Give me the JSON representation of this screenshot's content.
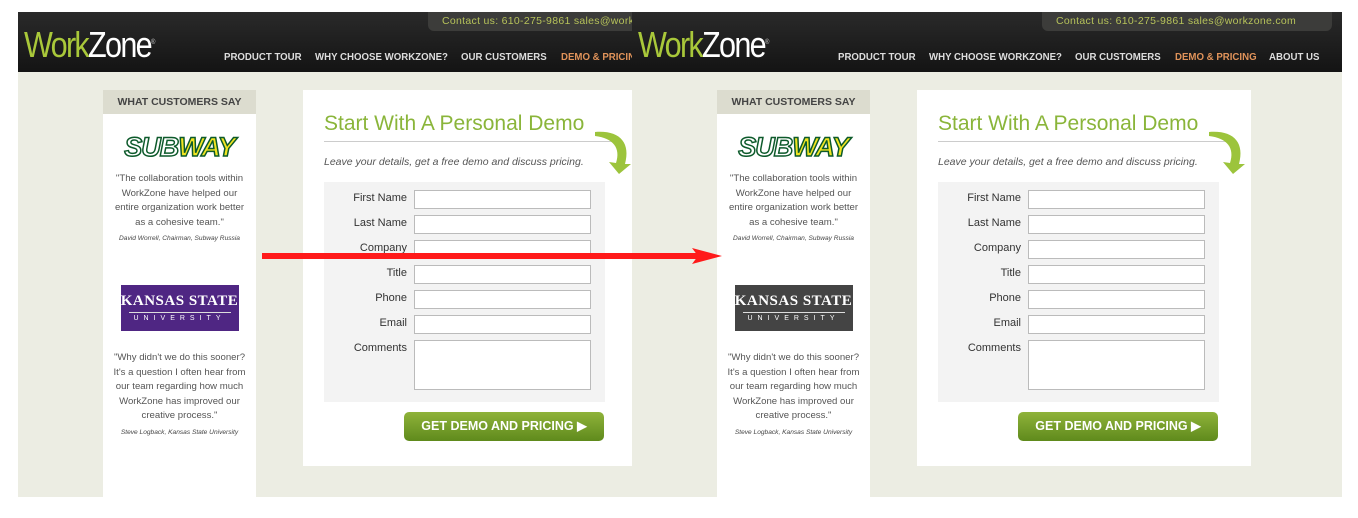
{
  "panels": [
    {
      "id": "before",
      "ksu_color": "#4f2683"
    },
    {
      "id": "after",
      "ksu_color": "#444444"
    }
  ],
  "header": {
    "logo_work": "Work",
    "logo_zone": "Zone",
    "contact": "Contact us:  610-275-9861   sales@workzone.com",
    "nav": [
      "PRODUCT TOUR",
      "WHY CHOOSE WORKZONE?",
      "OUR CUSTOMERS",
      "DEMO & PRICING",
      "ABOUT US"
    ],
    "active_nav": "DEMO & PRICING"
  },
  "sidebar": {
    "heading": "WHAT CUSTOMERS SAY",
    "subway_logo_a": "SUB",
    "subway_logo_b": "WAY",
    "quote1": "\"The collaboration tools within WorkZone have helped our entire organization work better as a cohesive team.\"",
    "author1": "David Worrell, Chairman, Subway Russia",
    "ksu_line1": "KANSAS STATE",
    "ksu_line2": "UNIVERSITY",
    "quote2": "\"Why didn't we do this sooner? It's a question I often hear from our team regarding how much WorkZone has improved our creative process.\"",
    "author2": "Steve Logback, Kansas State University"
  },
  "form": {
    "title": "Start With A Personal Demo",
    "subtitle": "Leave your details, get a free demo and discuss pricing.",
    "fields": [
      "First Name",
      "Last Name",
      "Company",
      "Title",
      "Phone",
      "Email",
      "Comments"
    ],
    "submit": "GET DEMO AND PRICING ▶"
  },
  "colors": {
    "accent_green": "#8ab53a",
    "annotation_arrow": "#ff1a1a",
    "nav_active": "#e0935a"
  }
}
